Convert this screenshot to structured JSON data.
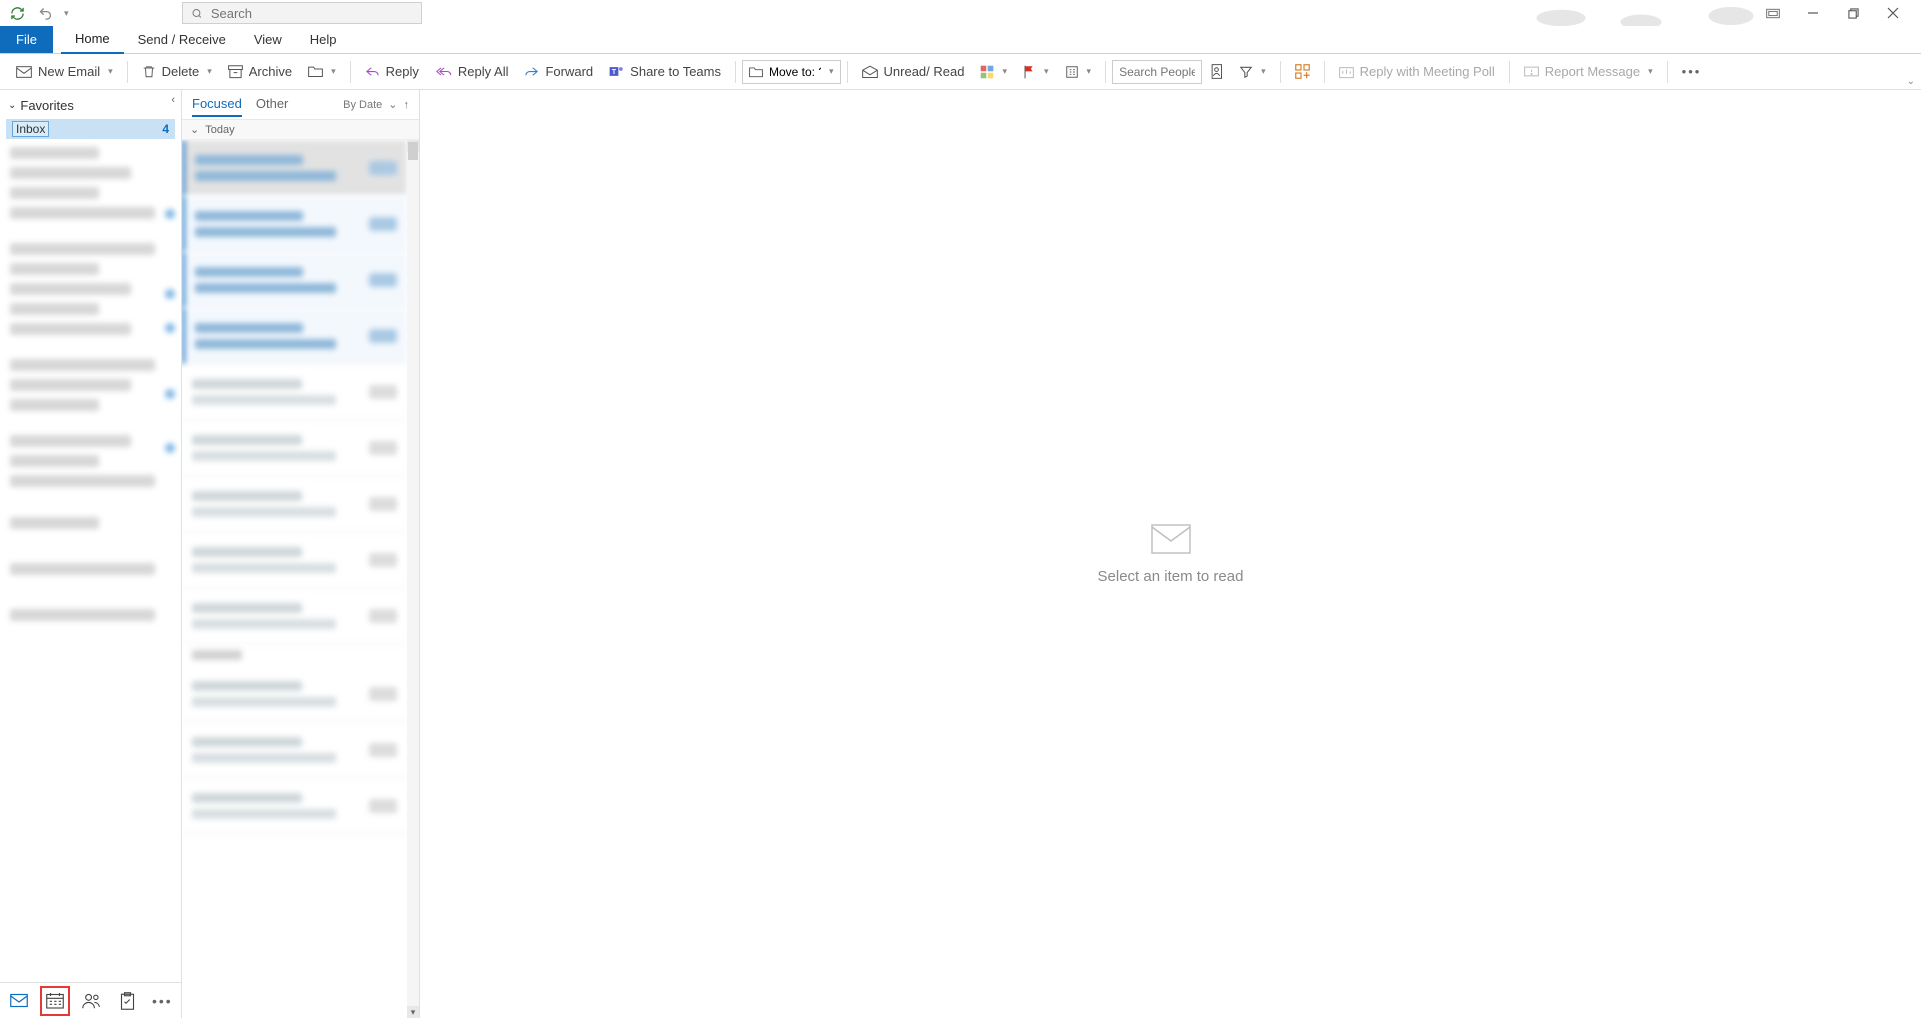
{
  "titlebar": {
    "search_placeholder": "Search"
  },
  "menu": {
    "file": "File",
    "tabs": [
      "Home",
      "Send / Receive",
      "View",
      "Help"
    ],
    "active": "Home"
  },
  "ribbon": {
    "new_email": "New Email",
    "delete": "Delete",
    "archive": "Archive",
    "reply": "Reply",
    "reply_all": "Reply All",
    "forward": "Forward",
    "share_teams": "Share to Teams",
    "move_to_label": "Move to: ?",
    "unread_read": "Unread/ Read",
    "search_people_placeholder": "Search People",
    "reply_meeting": "Reply with Meeting Poll",
    "report_msg": "Report Message"
  },
  "nav": {
    "favorites": "Favorites",
    "inbox_label": "Inbox",
    "inbox_count": "4"
  },
  "msglist": {
    "tabs": {
      "focused": "Focused",
      "other": "Other"
    },
    "sort_label": "By Date",
    "today": "Today"
  },
  "read": {
    "empty": "Select an item to read"
  }
}
